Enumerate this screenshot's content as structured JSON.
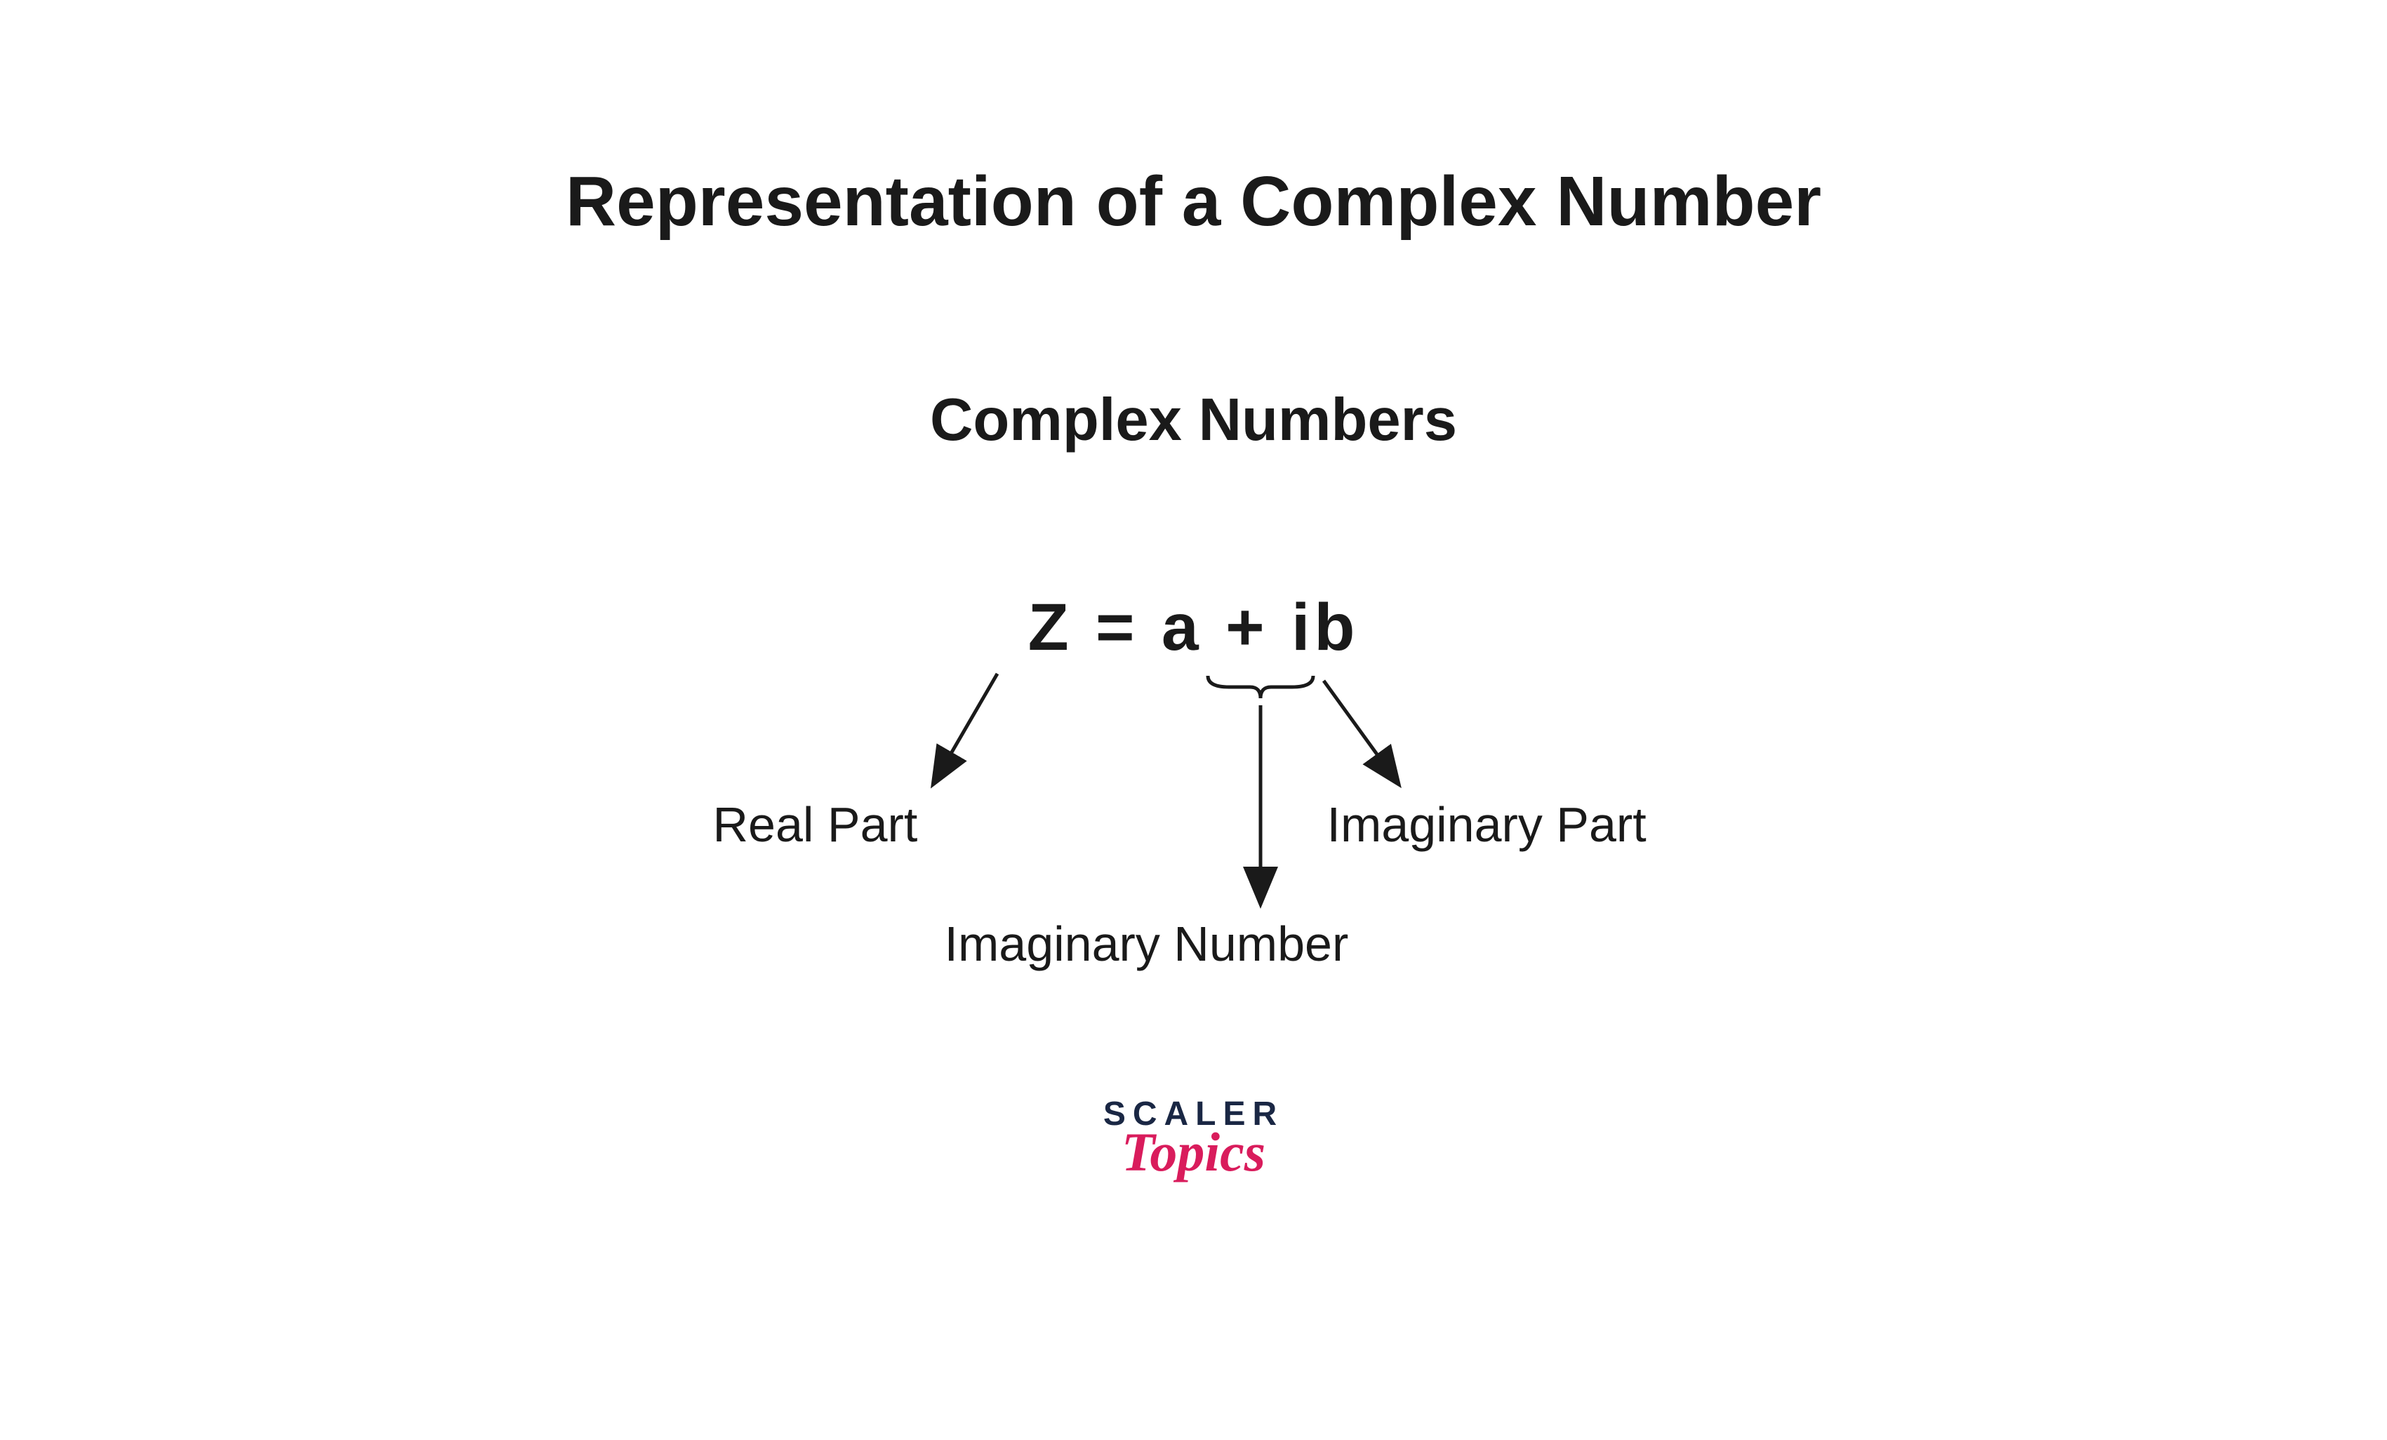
{
  "title": "Representation of a Complex Number",
  "subtitle": "Complex Numbers",
  "equation": "Z  =  a  +  ib",
  "labels": {
    "real": "Real Part",
    "imaginary_part": "Imaginary Part",
    "imaginary_number": "Imaginary Number"
  },
  "logo": {
    "line1": "SCALER",
    "line2": "Topics"
  }
}
